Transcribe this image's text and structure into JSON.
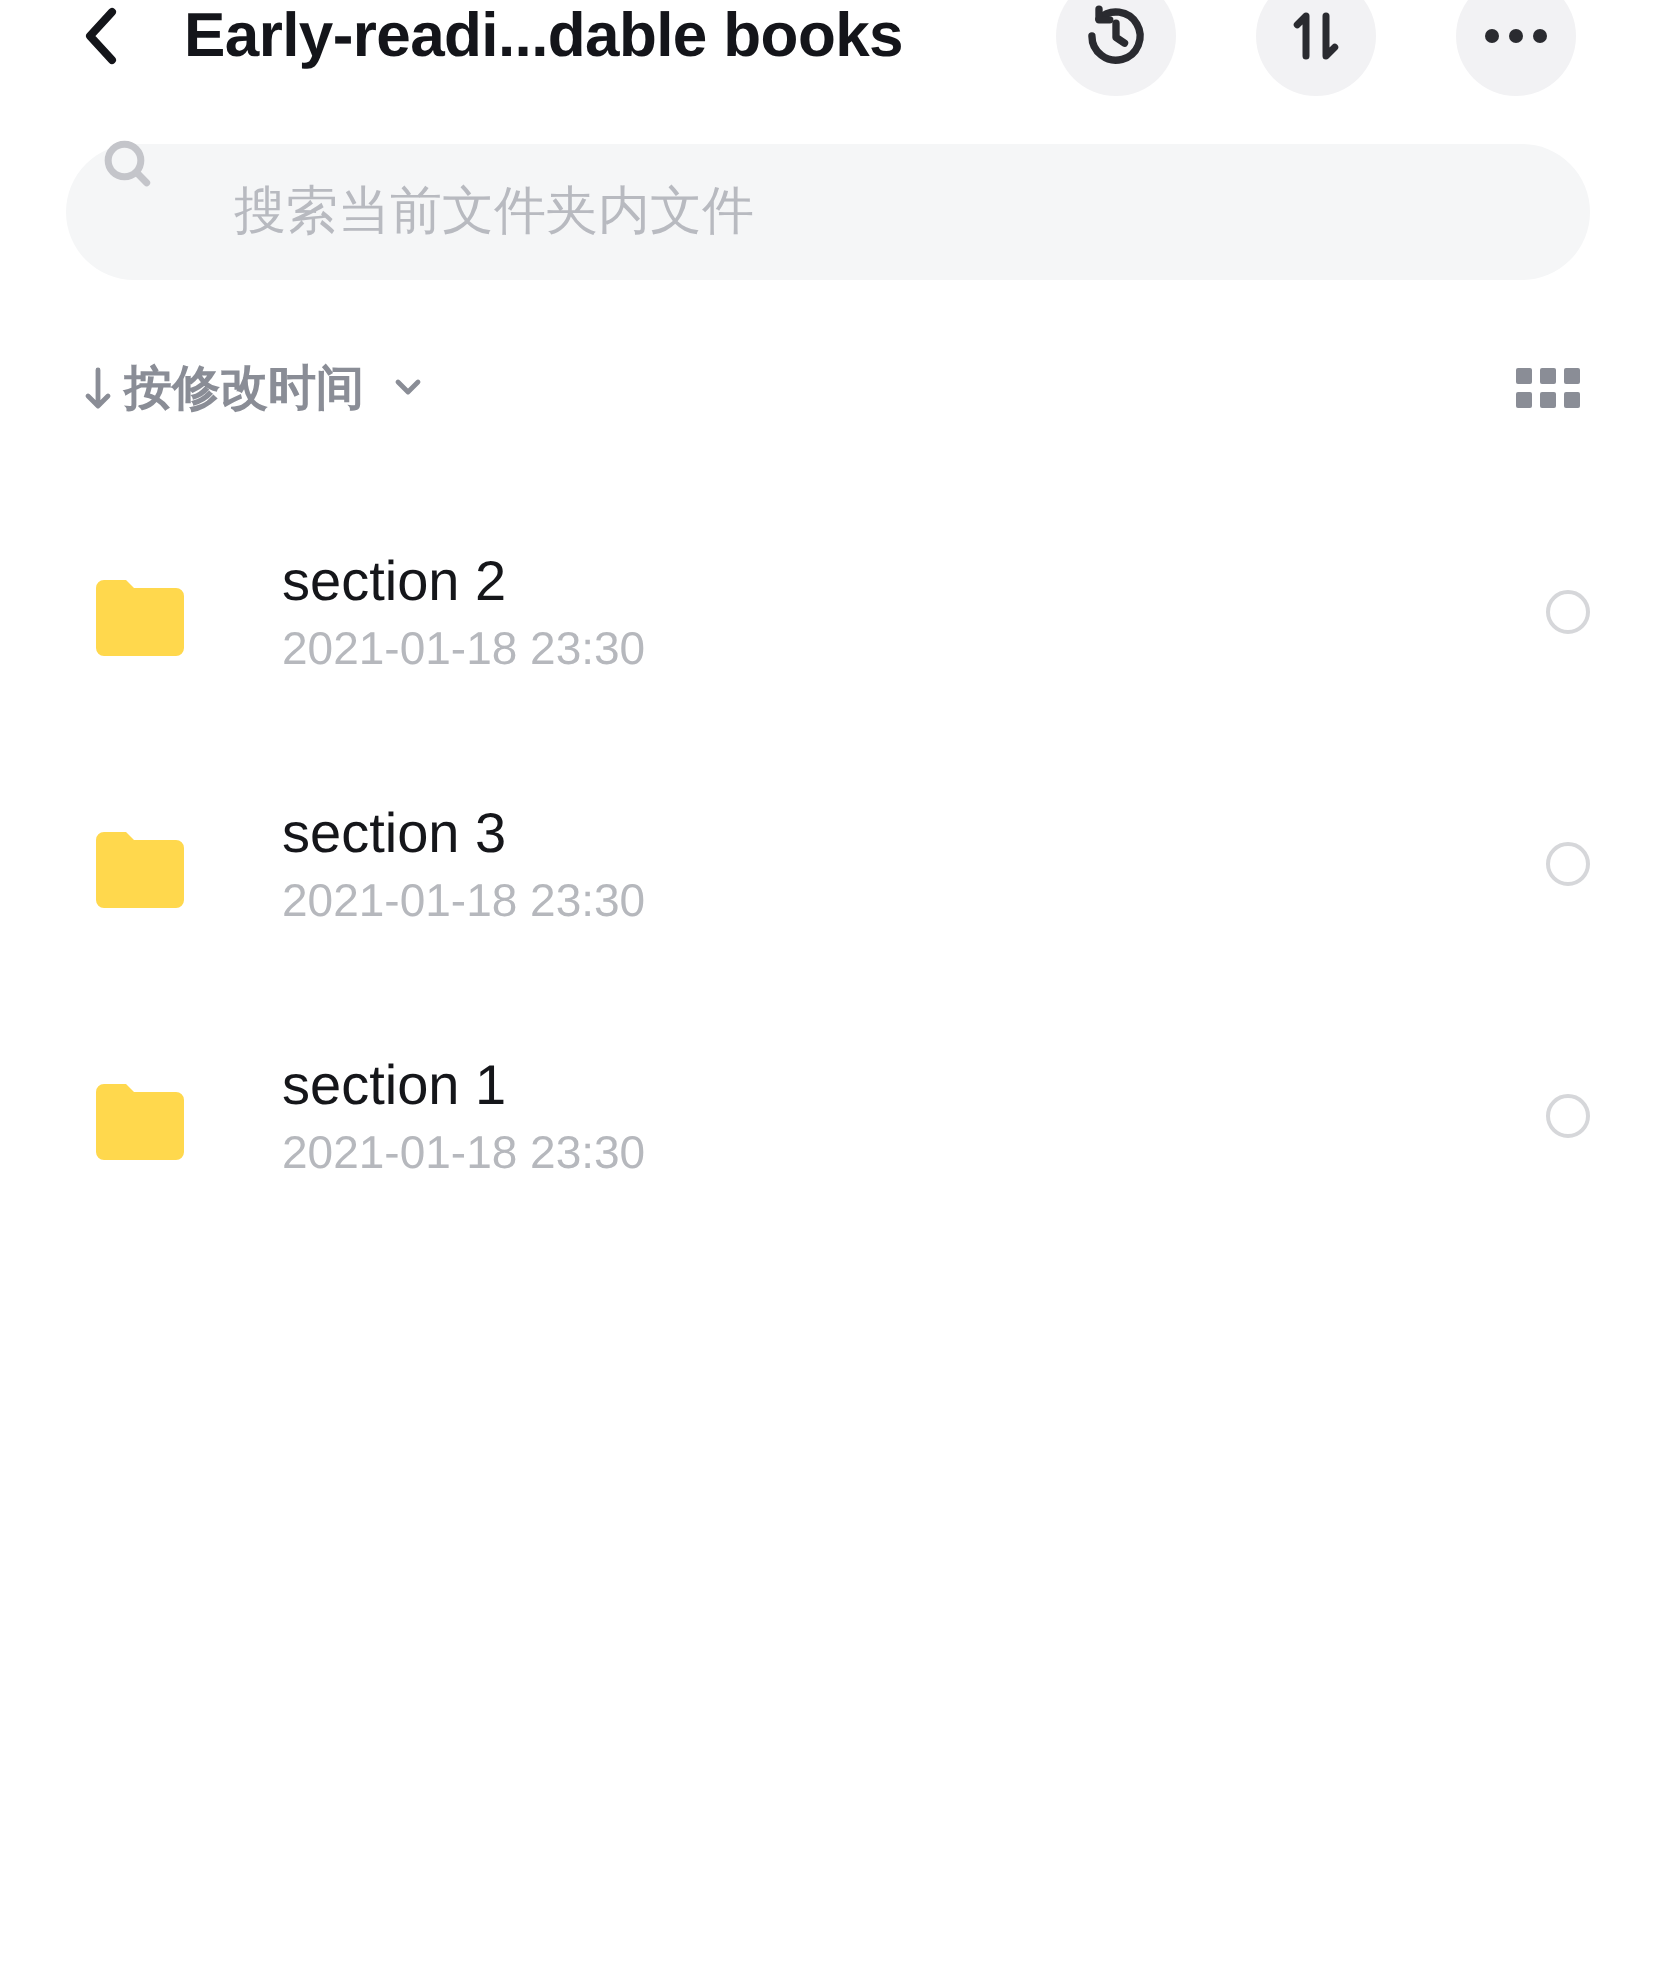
{
  "header": {
    "title": "Early-readi...dable books"
  },
  "search": {
    "placeholder": "搜索当前文件夹内文件"
  },
  "sort": {
    "label": "按修改时间"
  },
  "files": [
    {
      "name": "section 2",
      "modified": "2021-01-18 23:30",
      "selected": false
    },
    {
      "name": "section 3",
      "modified": "2021-01-18 23:30",
      "selected": false
    },
    {
      "name": "section 1",
      "modified": "2021-01-18 23:30",
      "selected": false
    }
  ]
}
